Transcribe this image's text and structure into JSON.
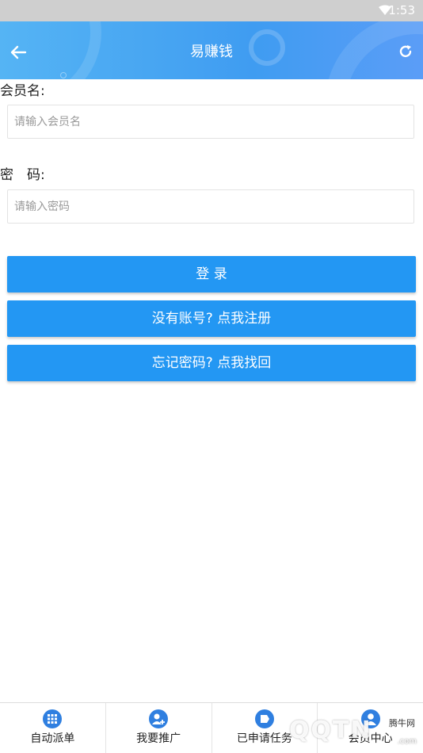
{
  "status_bar": {
    "time": "1:53",
    "wifi_icon": "wifi-icon"
  },
  "header": {
    "title": "易赚钱",
    "back_icon": "arrow-left-icon",
    "refresh_icon": "refresh-icon",
    "colors": {
      "start": "#55b4f4",
      "end": "#3f9cf1"
    }
  },
  "form": {
    "username_label": "会员名:",
    "username_placeholder": "请输入会员名",
    "username_value": "",
    "password_label": "密　码:",
    "password_placeholder": "请输入密码",
    "password_value": ""
  },
  "buttons": {
    "login": "登 录",
    "register": "没有账号? 点我注册",
    "forgot": "忘记密码? 点我找回",
    "color": "#2397f3"
  },
  "bottom_nav": {
    "items": [
      {
        "label": "自动派单",
        "icon": "grid-icon"
      },
      {
        "label": "我要推广",
        "icon": "user-add-icon"
      },
      {
        "label": "已申请任务",
        "icon": "tag-icon"
      },
      {
        "label": "会员中心",
        "icon": "user-icon"
      }
    ]
  },
  "watermark": {
    "brand": "QQTN",
    "site": "腾牛网",
    "domain": ".com"
  }
}
